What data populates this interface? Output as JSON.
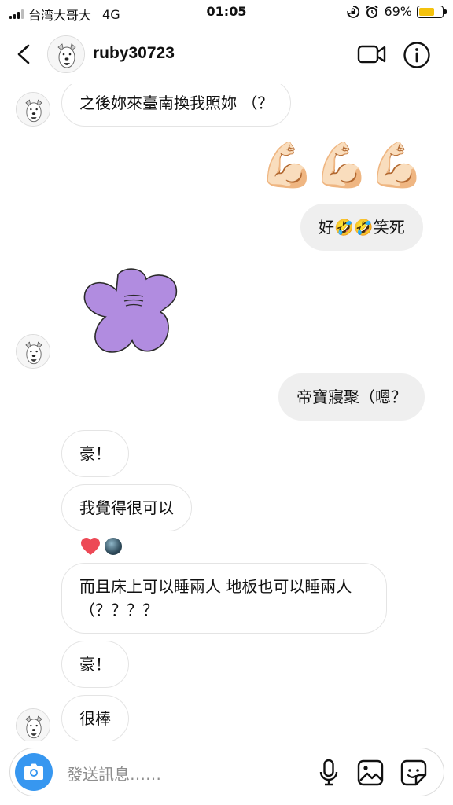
{
  "status_bar": {
    "carrier": "台湾大哥大",
    "network": "4G",
    "time": "01:05",
    "battery_percent": "69%",
    "battery_level": 0.69
  },
  "header": {
    "username": "ruby30723"
  },
  "messages": [
    {
      "direction": "in",
      "text": "之後妳來臺南換我照妳 （？"
    },
    {
      "direction": "out",
      "type": "emoji",
      "text": "💪🏻💪🏻💪🏻"
    },
    {
      "direction": "out",
      "text": "好🤣🤣笑死"
    },
    {
      "direction": "in",
      "type": "sticker",
      "sticker": "purple-flower-sticker"
    },
    {
      "direction": "out",
      "text": "帝寶寢聚（嗯？"
    },
    {
      "direction": "in",
      "text": "豪！"
    },
    {
      "direction": "in",
      "text": "我覺得很可以",
      "reactions": [
        "heart",
        "avatar"
      ]
    },
    {
      "direction": "in",
      "text": "而且床上可以睡兩人 地板也可以睡兩人 （？？？？"
    },
    {
      "direction": "in",
      "text": "豪！"
    },
    {
      "direction": "in",
      "text": "很棒"
    }
  ],
  "composer": {
    "placeholder": "發送訊息……"
  },
  "colors": {
    "accent": "#3797f0",
    "incoming_border": "#e4e4e4",
    "outgoing_bg": "#efefef",
    "battery": "#f4c20d",
    "heart": "#ed4956",
    "sticker": "#b18ce0"
  }
}
